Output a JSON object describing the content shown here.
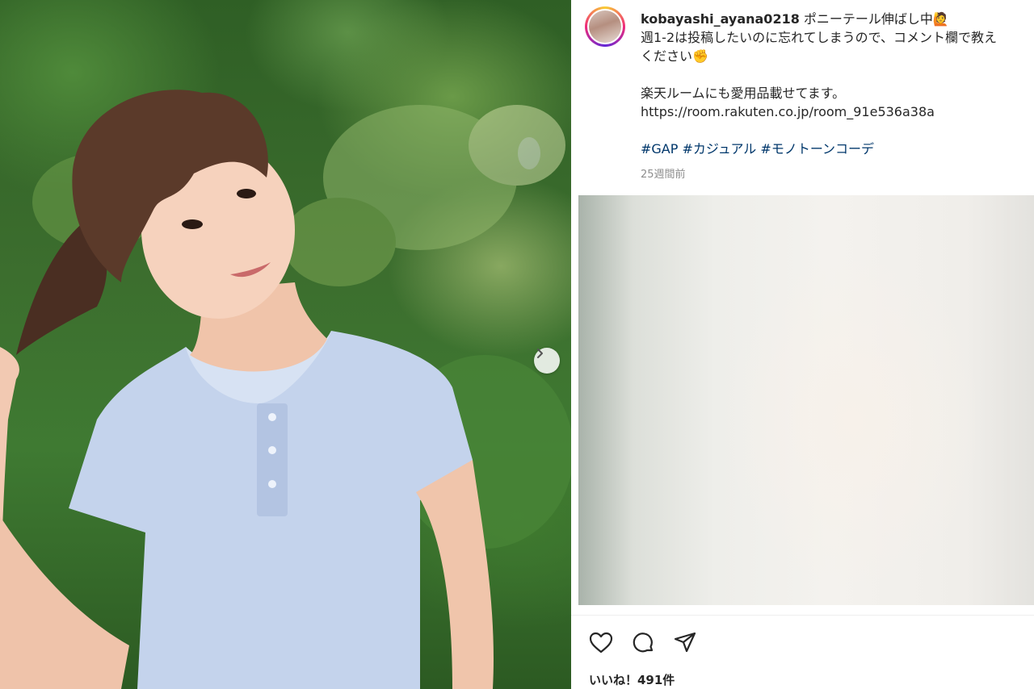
{
  "post": {
    "username": "kobayashi_ayana0218",
    "caption_line1": " ポニーテール伸ばし中🙋",
    "caption_line2": "週1-2は投稿したいのに忘れてしまうので、コメント欄で教え",
    "caption_line3": "ください✊",
    "caption_line4": "楽天ルームにも愛用品載せてます。",
    "caption_line5": "https://room.rakuten.co.jp/room_91e536a38a",
    "hashtags": [
      "#GAP",
      "#カジュアル",
      "#モノトーンコーデ"
    ],
    "time_ago": "25週間前",
    "likes": "いいね！491件"
  },
  "icons": {
    "next": "chevron-right-icon",
    "like": "heart-icon",
    "comment": "comment-icon",
    "share": "send-icon"
  },
  "colors": {
    "hashtag": "#00376b",
    "meta": "#8e8e8e",
    "text": "#262626"
  }
}
